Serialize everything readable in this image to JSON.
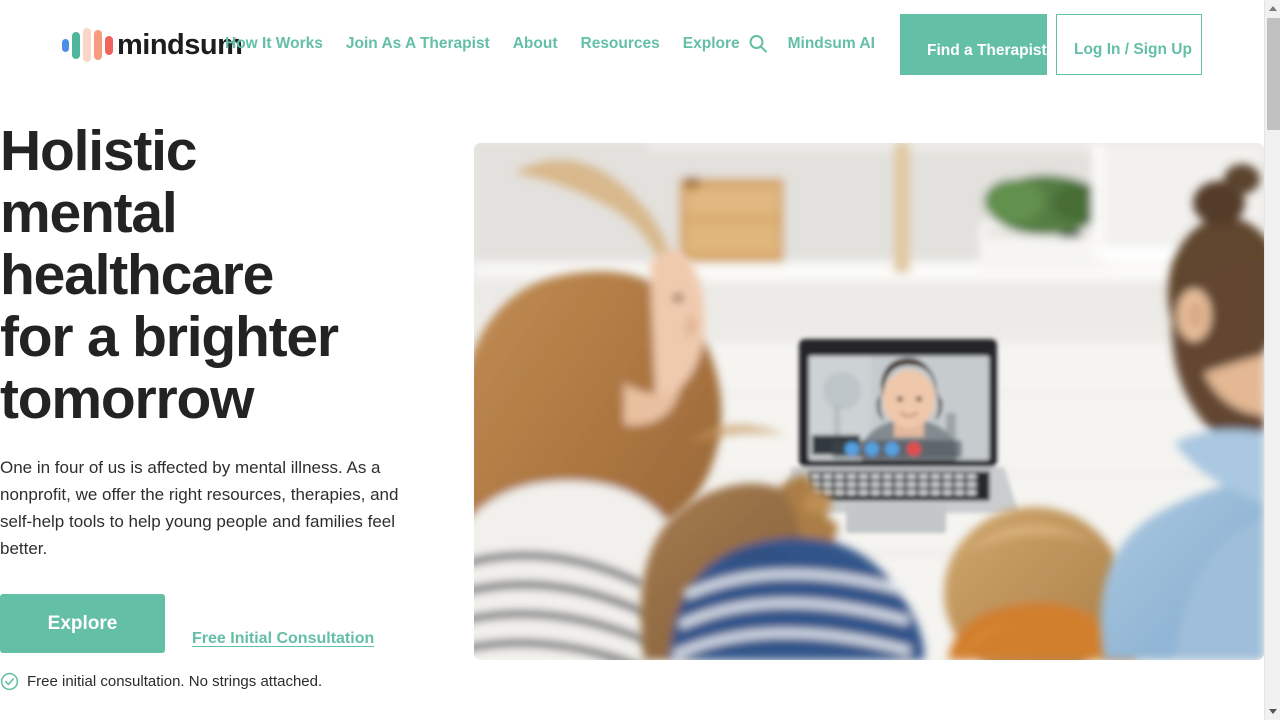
{
  "brand": {
    "name": "mindsum",
    "logo_icon": "mindsum-bars-logo",
    "accent_color": "#63bfa5",
    "bar_colors": [
      "#4c8fe8",
      "#4fb59c",
      "#fbd5c5",
      "#f79b7e",
      "#f0635c"
    ]
  },
  "nav": {
    "items": [
      {
        "label": "How It Works",
        "name": "nav-how-it-works"
      },
      {
        "label": "Join As A Therapist",
        "name": "nav-join-as-a-therapist"
      },
      {
        "label": "About",
        "name": "nav-about"
      },
      {
        "label": "Resources",
        "name": "nav-resources"
      },
      {
        "label": "Explore",
        "name": "nav-explore"
      },
      {
        "label": "Mindsum AI",
        "name": "nav-mindsum-ai"
      }
    ],
    "search_icon": "search-icon"
  },
  "header_buttons": {
    "find_therapist": "Find a Therapist",
    "login_signup": "Log In / Sign Up"
  },
  "hero": {
    "title": "Holistic mental healthcare for a brighter tomorrow",
    "subtitle": "One in four of us is affected by mental illness. As a nonprofit, we offer the right resources, therapies, and self-help tools to help young people and families feel better.",
    "primary_cta": "Explore",
    "secondary_cta": "Free Initial Consultation",
    "assurance": "Free initial consultation. No strings attached.",
    "assurance_icon": "check-circle-icon",
    "image_alt": "family watching an online therapy video call on a laptop"
  },
  "scrollbar": {
    "up_arrow_icon": "scroll-up-arrow-icon",
    "down_arrow_icon": "scroll-down-arrow-icon",
    "thumb": "scrollbar-thumb"
  }
}
